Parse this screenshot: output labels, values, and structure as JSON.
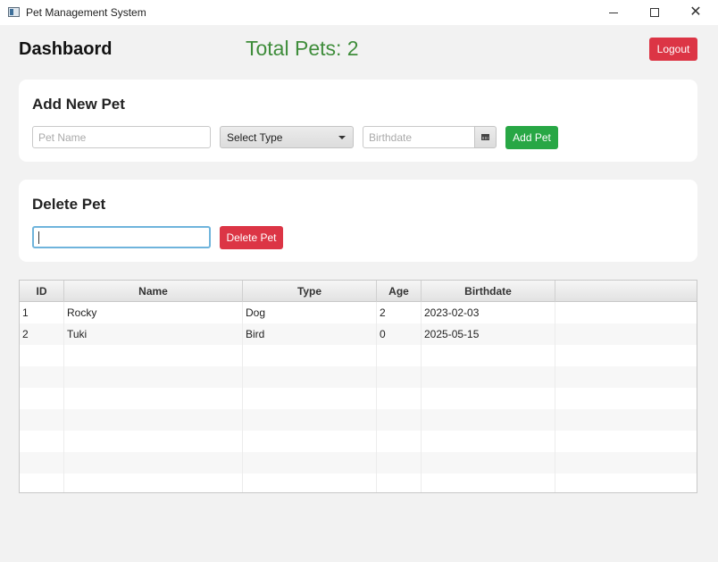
{
  "window": {
    "title": "Pet Management System",
    "app_icon": "app-window-icon"
  },
  "header": {
    "title": "Dashbaord",
    "total_pets": "Total Pets: 2",
    "logout_label": "Logout"
  },
  "add_pet": {
    "title": "Add New Pet",
    "pet_name_placeholder": "Pet Name",
    "pet_name_value": "",
    "type_selected": "Select Type",
    "birthdate_placeholder": "Birthdate",
    "birthdate_value": "",
    "add_label": "Add Pet"
  },
  "delete_pet": {
    "title": "Delete Pet",
    "id_value": "",
    "delete_label": "Delete Pet"
  },
  "table": {
    "columns": [
      "ID",
      "Name",
      "Type",
      "Age",
      "Birthdate",
      ""
    ],
    "rows": [
      [
        "1",
        "Rocky",
        "Dog",
        "2",
        "2023-02-03"
      ],
      [
        "2",
        "Tuki",
        "Bird",
        "0",
        "2025-05-15"
      ]
    ]
  },
  "colors": {
    "accent_green": "#28a745",
    "danger_red": "#dc3545",
    "total_text": "#3f8d3b"
  }
}
